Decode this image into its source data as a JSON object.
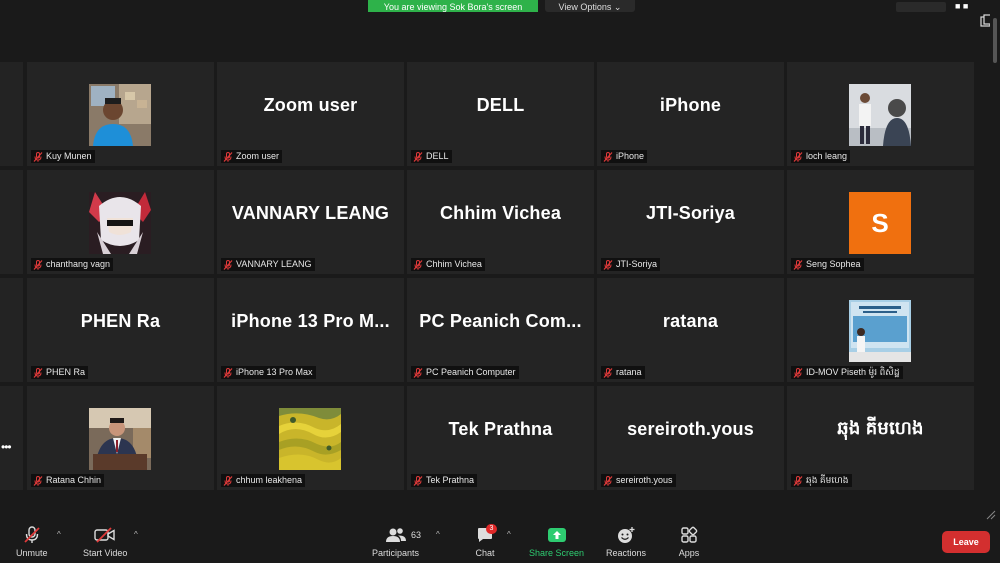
{
  "topbar": {
    "viewing_banner": "You are viewing Sok Bora's screen",
    "view_options": "View Options ⌄",
    "menu_dots": "■ ■"
  },
  "tiles": [
    {
      "caption": "Kuy Munen",
      "display": "photo",
      "photo": "person-warehouse"
    },
    {
      "caption": "Zoom user",
      "display": "name",
      "big_name": "Zoom user"
    },
    {
      "caption": "DELL",
      "display": "name",
      "big_name": "DELL"
    },
    {
      "caption": "iPhone",
      "display": "name",
      "big_name": "iPhone"
    },
    {
      "caption": "loch leang",
      "display": "photo",
      "photo": "person-standing"
    },
    {
      "caption": "chanthang vagn",
      "display": "photo",
      "photo": "anime-avatar"
    },
    {
      "caption": "VANNARY LEANG",
      "display": "name",
      "big_name": "VANNARY LEANG"
    },
    {
      "caption": "Chhim Vichea",
      "display": "name",
      "big_name": "Chhim Vichea"
    },
    {
      "caption": "JTI-Soriya",
      "display": "name",
      "big_name": "JTI-Soriya"
    },
    {
      "caption": "Seng Sophea",
      "display": "letter",
      "letter": "S"
    },
    {
      "caption": "PHEN Ra",
      "display": "name",
      "big_name": "PHEN Ra"
    },
    {
      "caption": "iPhone 13 Pro Max",
      "display": "name",
      "big_name": "iPhone 13 Pro M..."
    },
    {
      "caption": "PC Peanich Computer",
      "display": "name",
      "big_name": "PC Peanich Com..."
    },
    {
      "caption": "ratana",
      "display": "name",
      "big_name": "ratana"
    },
    {
      "caption": "ID-MOV Piseth ម៉ូរ ពិសិដ្ឋ",
      "display": "photo",
      "photo": "presenter-banner"
    },
    {
      "caption": "Ratana Chhin",
      "display": "photo",
      "photo": "man-in-suit"
    },
    {
      "caption": "chhum leakhena",
      "display": "photo",
      "photo": "rice-terraces"
    },
    {
      "caption": "Tek Prathna",
      "display": "name",
      "big_name": "Tek Prathna"
    },
    {
      "caption": "sereiroth.yous",
      "display": "name",
      "big_name": "sereiroth.yous"
    },
    {
      "caption": "ឆុង គីមហេង",
      "display": "name",
      "big_name": "ឆុង គីមហេង"
    }
  ],
  "side_more": "•••",
  "toolbar": {
    "unmute": "Unmute",
    "start_video": "Start Video",
    "participants": "Participants",
    "participants_count": "63",
    "chat": "Chat",
    "chat_badge": "3",
    "share_screen": "Share Screen",
    "reactions": "Reactions",
    "apps": "Apps",
    "leave": "Leave"
  },
  "colors": {
    "share_green": "#2ecc71",
    "leave_red": "#d32f2f",
    "banner_green": "#2eb24a",
    "avatar_orange": "#f0700f",
    "mute_red": "#e03a3a"
  }
}
